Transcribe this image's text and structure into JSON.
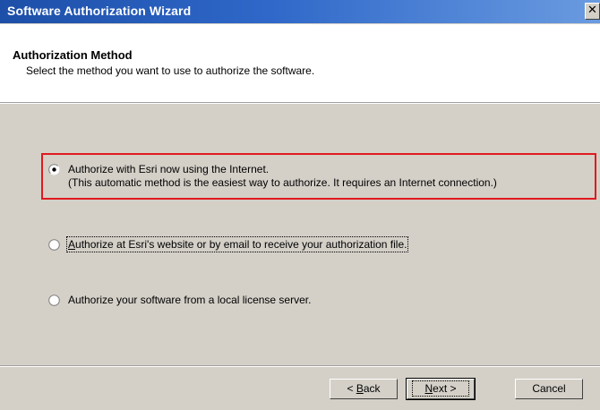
{
  "window": {
    "title": "Software Authorization Wizard",
    "close_glyph": "✕"
  },
  "header": {
    "title": "Authorization Method",
    "subtitle": "Select the method you want to use to authorize the software."
  },
  "options": [
    {
      "label": "Authorize with Esri now using the Internet.",
      "description": "(This automatic method is the easiest way to authorize. It requires an Internet connection.)",
      "selected": true
    },
    {
      "label_first": "A",
      "label_rest": "uthorize at Esri's website or by email to receive your authorization file.",
      "selected": false
    },
    {
      "label": "Authorize your software from a local license server.",
      "selected": false
    }
  ],
  "buttons": {
    "back_prefix": "< ",
    "back_accel": "B",
    "back_rest": "ack",
    "next_accel": "N",
    "next_rest": "ext >",
    "cancel": "Cancel"
  },
  "colors": {
    "highlight": "#e0191f",
    "titlebar": "#1d4fa8",
    "face": "#d4d0c8"
  }
}
